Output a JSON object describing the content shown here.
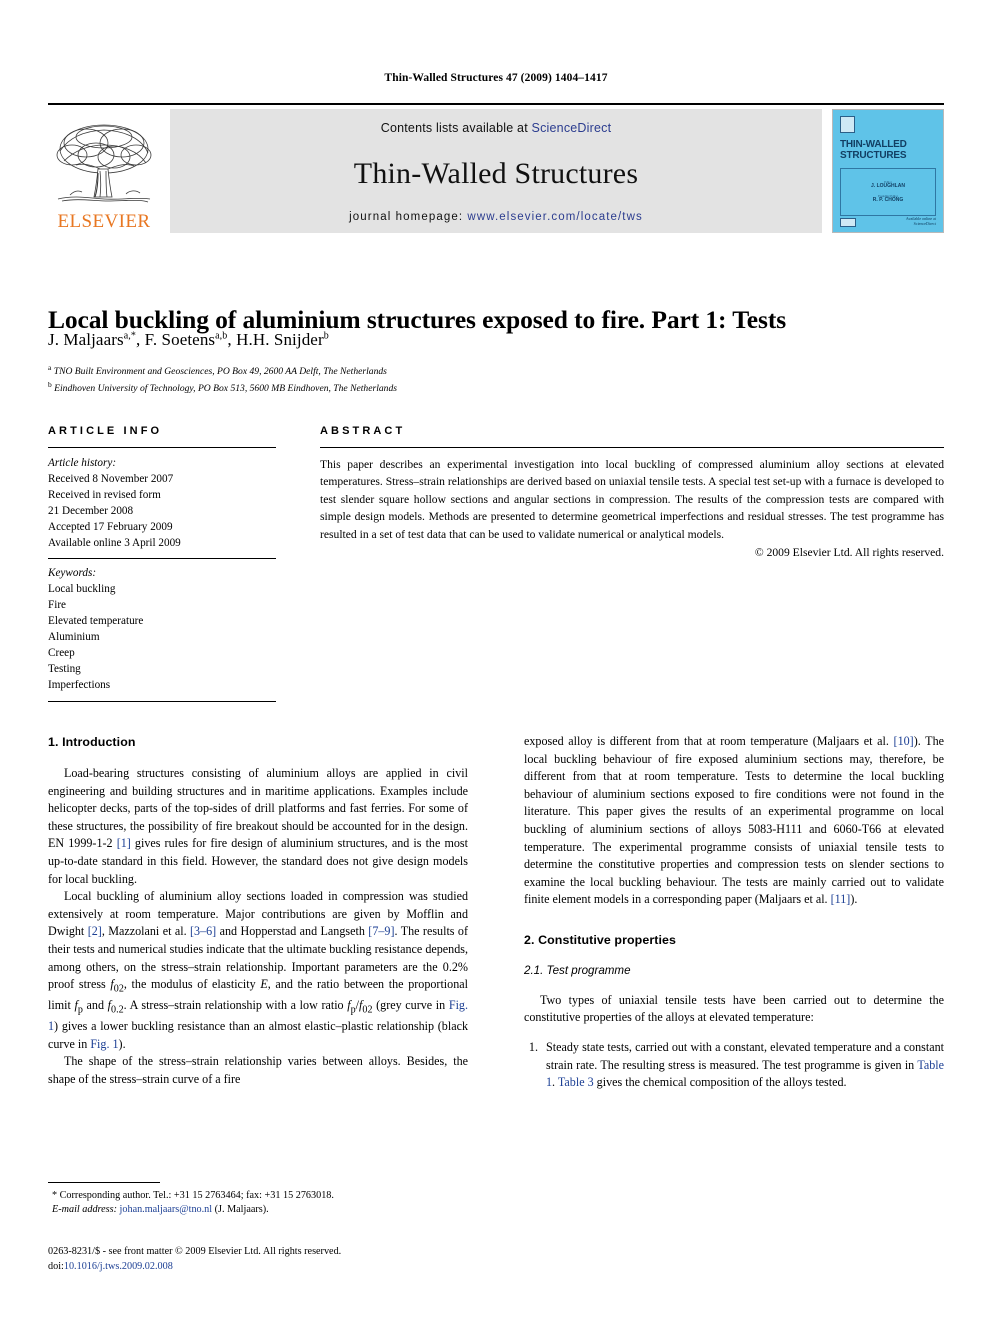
{
  "running_head": "Thin-Walled Structures 47 (2009) 1404–1417",
  "masthead": {
    "elsevier_wordmark": "ELSEVIER",
    "contents_prefix": "Contents lists available at ",
    "contents_link": "ScienceDirect",
    "journal_name": "Thin-Walled Structures",
    "homepage_prefix": "journal homepage: ",
    "homepage_url": "www.elsevier.com/locate/tws",
    "cover": {
      "title_line1": "THIN-WALLED",
      "title_line2": "STRUCTURES",
      "editor_label": "Editor",
      "editor_name": "J. LOUGHLAN",
      "coeditor_label": "Founding Editor",
      "coeditor_name": "R. P. CHONG",
      "sciencedirect_note": "Available online at",
      "sciencedirect_name": "ScienceDirect"
    }
  },
  "article": {
    "title": "Local buckling of aluminium structures exposed to fire. Part 1: Tests",
    "authors_plain": "J. Maljaars a,*, F. Soetens a,b, H.H. Snijder b",
    "affiliation_a": "TNO Built Environment and Geosciences, PO Box 49, 2600 AA Delft, The Netherlands",
    "affiliation_b": "Eindhoven University of Technology, PO Box 513, 5600 MB Eindhoven, The Netherlands"
  },
  "info": {
    "heading": "ARTICLE INFO",
    "history_label": "Article history:",
    "history": [
      "Received 8 November 2007",
      "Received in revised form",
      "21 December 2008",
      "Accepted 17 February 2009",
      "Available online 3 April 2009"
    ],
    "keywords_label": "Keywords:",
    "keywords": [
      "Local buckling",
      "Fire",
      "Elevated temperature",
      "Aluminium",
      "Creep",
      "Testing",
      "Imperfections"
    ]
  },
  "abstract": {
    "heading": "ABSTRACT",
    "text": "This paper describes an experimental investigation into local buckling of compressed aluminium alloy sections at elevated temperatures. Stress–strain relationships are derived based on uniaxial tensile tests. A special test set-up with a furnace is developed to test slender square hollow sections and angular sections in compression. The results of the compression tests are compared with simple design models. Methods are presented to determine geometrical imperfections and residual stresses. The test programme has resulted in a set of test data that can be used to validate numerical or analytical models.",
    "copyright": "© 2009 Elsevier Ltd. All rights reserved."
  },
  "sections": {
    "intro_heading": "1. Introduction",
    "intro_p1": "Load-bearing structures consisting of aluminium alloys are applied in civil engineering and building structures and in maritime applications. Examples include helicopter decks, parts of the top-sides of drill platforms and fast ferries. For some of these structures, the possibility of fire breakout should be accounted for in the design. EN 1999-1-2 [1] gives rules for fire design of aluminium structures, and is the most up-to-date standard in this field. However, the standard does not give design models for local buckling.",
    "intro_p2": "Local buckling of aluminium alloy sections loaded in compression was studied extensively at room temperature. Major contributions are given by Mofflin and Dwight [2], Mazzolani et al. [3–6] and Hopperstad and Langseth [7–9]. The results of their tests and numerical studies indicate that the ultimate buckling resistance depends, among others, on the stress–strain relationship. Important parameters are the 0.2% proof stress f02, the modulus of elasticity E, and the ratio between the proportional limit fp and f0.2. A stress–strain relationship with a low ratio fp/f02 (grey curve in Fig. 1) gives a lower buckling resistance than an almost elastic–plastic relationship (black curve in Fig. 1).",
    "intro_p3": "The shape of the stress–strain relationship varies between alloys. Besides, the shape of the stress–strain curve of a fire exposed alloy is different from that at room temperature (Maljaars et al. [10]). The local buckling behaviour of fire exposed aluminium sections may, therefore, be different from that at room temperature. Tests to determine the local buckling behaviour of aluminium sections exposed to fire conditions were not found in the literature. This paper gives the results of an experimental programme on local buckling of aluminium sections of alloys 5083-H111 and 6060-T66 at elevated temperature. The experimental programme consists of uniaxial tensile tests to determine the constitutive properties and compression tests on slender sections to examine the local buckling behaviour. The tests are mainly carried out to validate finite element models in a corresponding paper (Maljaars et al. [11]).",
    "constitutive_heading": "2. Constitutive properties",
    "test_programme_heading": "2.1. Test programme",
    "test_programme_p1": "Two types of uniaxial tensile tests have been carried out to determine the constitutive properties of the alloys at elevated temperature:",
    "list_item_1": "Steady state tests, carried out with a constant, elevated temperature and a constant strain rate. The resulting stress is measured. The test programme is given in Table 1. Table 3 gives the chemical composition of the alloys tested."
  },
  "footnote": {
    "corresponding": "Corresponding author. Tel.: +31 15 2763464; fax: +31 15 2763018.",
    "email_label": "E-mail address:",
    "email": "johan.maljaars@tno.nl",
    "email_owner": "(J. Maljaars)."
  },
  "imprint": {
    "line1": "0263-8231/$ - see front matter © 2009 Elsevier Ltd. All rights reserved.",
    "doi_label": "doi:",
    "doi": "10.1016/j.tws.2009.02.008"
  },
  "colors": {
    "link": "#1c3f94",
    "elsevier_orange": "#E87722",
    "banner_grey": "#e3e3e3",
    "cover_blue": "#5fc3e8"
  }
}
